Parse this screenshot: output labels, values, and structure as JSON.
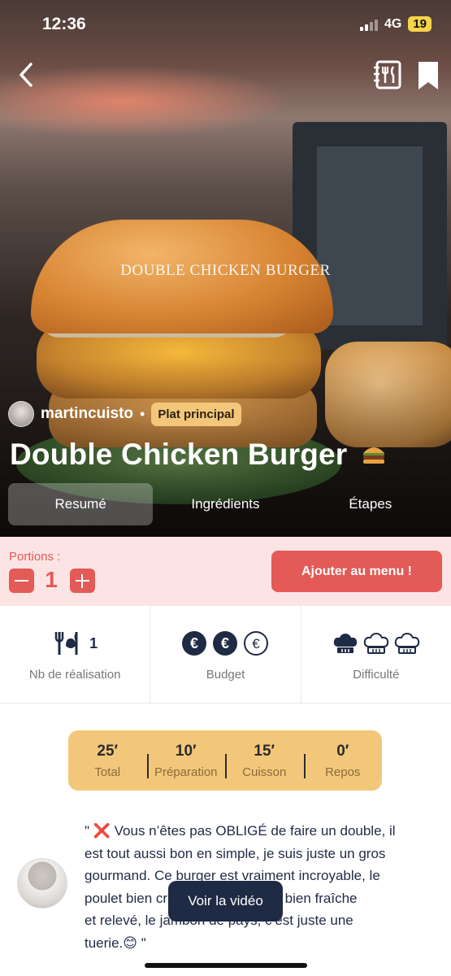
{
  "status_bar": {
    "time": "12:36",
    "network": "4G",
    "battery": "19"
  },
  "hero": {
    "bun_text": "DOUBLE CHICKEN BURGER",
    "author": "martincuisto",
    "separator": "•",
    "category": "Plat principal",
    "title": "Double Chicken Burger"
  },
  "tabs": [
    {
      "label": "Resumé",
      "active": true
    },
    {
      "label": "Ingrédients",
      "active": false
    },
    {
      "label": "Étapes",
      "active": false
    }
  ],
  "portions": {
    "label": "Portions :",
    "count": "1",
    "add_button": "Ajouter au menu !"
  },
  "stats": {
    "realisations": {
      "value": "1",
      "label": "Nb de réalisation"
    },
    "budget": {
      "label": "Budget",
      "level": 2,
      "max": 3
    },
    "difficulty": {
      "label": "Difficulté",
      "level": 1,
      "max": 3
    }
  },
  "times": [
    {
      "value": "25′",
      "label": "Total"
    },
    {
      "value": "10′",
      "label": "Préparation"
    },
    {
      "value": "15′",
      "label": "Cuisson"
    },
    {
      "value": "0′",
      "label": "Repos"
    }
  ],
  "description": {
    "line1": "\" ❌ Vous n’êtes pas OBLIGÉ de faire un double, il",
    "line2": "est tout aussi bon en simple, je suis juste un gros",
    "line3": "gourmand. Ce burger est vraiment incroyable, le",
    "line4": "poulet bien croustillant, la sauce bien fraîche",
    "line5": "et relevé, le jambon de pays, c’est juste une",
    "line6": "tuerie.😊 \""
  },
  "video_button": "Voir la vidéo",
  "colors": {
    "accent": "#e35a57",
    "accent_light": "#fbe4e3",
    "gold": "#f3c77a",
    "navy": "#1f2a44"
  }
}
